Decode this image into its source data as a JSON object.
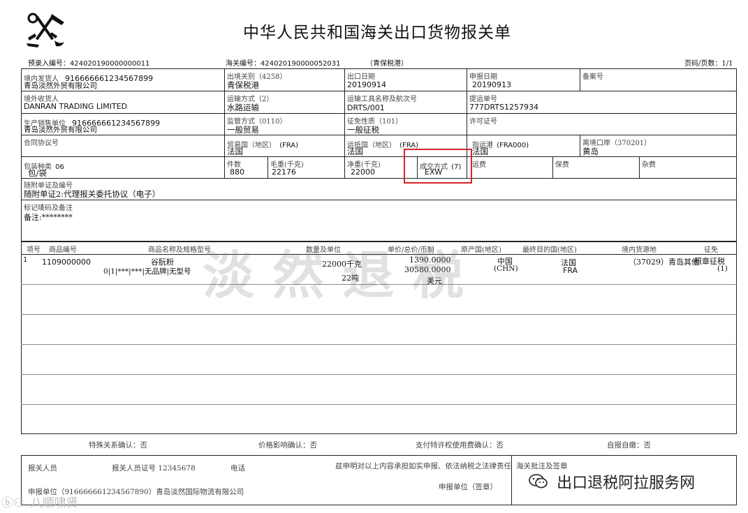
{
  "header": {
    "title": "中华人民共和国海关出口货物报关单",
    "pre_entry_label": "预录入编号：",
    "pre_entry_no": "424020190000000011",
    "customs_no_label": "海关编号：",
    "customs_no": "424020190000052031",
    "port_tag": "（青保税港）",
    "page_label": "页码/页数：1/1"
  },
  "row1": {
    "consignor_label": "境内发货人",
    "consignor_code": "916666661234567899",
    "consignor_name": "青岛淡然外贸有限公司",
    "exit_customs_label": "出境关别（4258）",
    "exit_customs": "青保税港",
    "export_date_label": "出口日期",
    "export_date": "20190914",
    "declare_date_label": "申报日期",
    "declare_date": "20190913",
    "record_no_label": "备案号"
  },
  "row2": {
    "consignee_label": "境外收货人",
    "consignee": "DANRAN TRADING LIMITED",
    "transport_mode_label": "运输方式（2）",
    "transport_mode": "水路运输",
    "vessel_label": "运输工具名称及航次号",
    "vessel": "DRTS/001",
    "bl_label": "提运单号",
    "bl_no": "777DRTS1257934"
  },
  "row3": {
    "producer_label": "生产销售单位",
    "producer_code": "916666661234567899",
    "producer_name": "青岛淡然外贸有限公司",
    "supervision_label": "监管方式（0110）",
    "supervision": "一般贸易",
    "tax_label": "征免性质（101）",
    "tax": "一般征税",
    "license_label": "许可证号"
  },
  "row4": {
    "contract_label": "合同协议号",
    "trade_country_label": "贸易国（地区）",
    "trade_country_code": "(FRA)",
    "trade_country": "法国",
    "dest_country_label": "运抵国（地区）",
    "dest_country_code": "(FRA)",
    "dest_country": "法国",
    "dest_port_label": "指运港",
    "dest_port_code": "(FRA000)",
    "dest_port": "法国",
    "exit_port_label": "离境口岸（370201）",
    "exit_port": "黄岛"
  },
  "row5": {
    "pack_label": "包装种类",
    "pack_code": "06",
    "pack": "包/袋",
    "pieces_label": "件数",
    "pieces": "880",
    "gross_label": "毛重(千克)",
    "gross": "22176",
    "net_label": "净重(千克)",
    "net": "22000",
    "terms_label": "成交方式",
    "terms_code": "(7)",
    "terms": "EXW",
    "freight_label": "运费",
    "insurance_label": "保费",
    "misc_label": "杂费"
  },
  "docs": {
    "label": "随附单证及编号",
    "value": "随附单证2:代理报关委托协议（电子）"
  },
  "marks": {
    "label": "标记唛码及备注",
    "value": "备注:********"
  },
  "goods": {
    "headers": [
      "项号",
      "商品编号",
      "商品名称及规格型号",
      "数量及单位",
      "单价/总价/币制",
      "原产国(地区)",
      "最终目的国(地区)",
      "境内货源地",
      "征免"
    ],
    "item": {
      "no": "1",
      "code": "1109000000",
      "name": "谷朊粉",
      "spec": "0|1|***|***|无品牌|无型号",
      "qty1": "22000千克",
      "qty2": "22吨",
      "unit_price": "1390.0000",
      "total_price": "30580.0000",
      "currency": "美元",
      "origin": "中国",
      "origin_code": "(CHN)",
      "dest": "法国",
      "dest_code": "FRA",
      "source": "（37029）青岛其他",
      "levy": "照章征税",
      "levy_code": "(1)"
    }
  },
  "confirm": {
    "special": "特殊关系确认：否",
    "price": "价格影响确认：否",
    "royalty": "支付特许权使用费确认：否",
    "self": "自报自缴：否"
  },
  "footer": {
    "declarant_label": "报关人员",
    "declarant_cert": "报关人员证号 12345678",
    "phone_label": "电话",
    "statement": "兹申明对以上内容承担如实申报、依法纳税之法律责任",
    "customs_sign_label": "海关批注及签章",
    "unit": "申报单位（916666661234567890）青岛淡然国际物流有限公司",
    "unit_sign": "申报单位（签章）"
  },
  "watermark": "淡然退税",
  "overlays": {
    "wechat_text": "出口退税阿拉服务网",
    "corner_text": "八顺啸贤"
  },
  "colors": {
    "highlight_box": "#d9262b",
    "watermark": "#999999"
  }
}
